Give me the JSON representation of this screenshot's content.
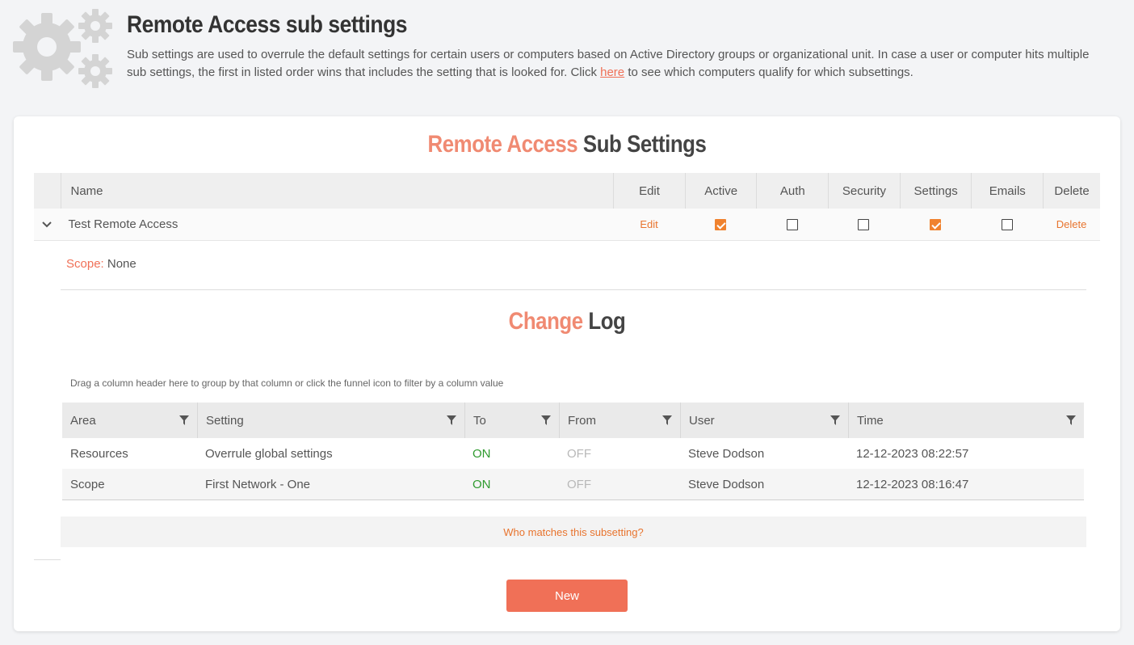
{
  "header": {
    "title": "Remote Access sub settings",
    "description_before_link": "Sub settings are used to overrule the default settings for certain users or computers based on Active Directory groups or organizational unit. In case a user or computer hits multiple sub settings, the first in listed order wins that includes the setting that is looked for. Click ",
    "link_text": "here",
    "description_after_link": " to see which computers qualify for which subsettings.",
    "icon": "gears-icon"
  },
  "card": {
    "title_accent": "Remote Access",
    "title_rest": " Sub Settings"
  },
  "main_grid": {
    "columns": [
      "Name",
      "Edit",
      "Active",
      "Auth",
      "Security",
      "Settings",
      "Emails",
      "Delete"
    ],
    "rows": [
      {
        "name": "Test Remote Access",
        "edit_label": "Edit",
        "active": true,
        "auth": false,
        "security": false,
        "settings": true,
        "emails": false,
        "delete_label": "Delete"
      }
    ]
  },
  "detail": {
    "scope_label": "Scope:",
    "scope_value": " None",
    "changelog_title_accent": "Change",
    "changelog_title_rest": " Log",
    "drag_hint": "Drag a column header here to group by that column or click the funnel icon to filter by a column value",
    "log_columns": [
      "Area",
      "Setting",
      "To",
      "From",
      "User",
      "Time"
    ],
    "log_rows": [
      {
        "area": "Resources",
        "setting": "Overrule global settings",
        "to": "ON",
        "from": "OFF",
        "user": "Steve Dodson",
        "time": "12-12-2023 08:22:57"
      },
      {
        "area": "Scope",
        "setting": "First Network - One",
        "to": "ON",
        "from": "OFF",
        "user": "Steve Dodson",
        "time": "12-12-2023 08:16:47"
      }
    ],
    "who_matches": "Who matches this subsetting?"
  },
  "new_button": "New",
  "colors": {
    "accent": "#f07057",
    "link_orange": "#e8742e",
    "checkbox_on": "#f0822e",
    "on_green": "#2e9a2e",
    "off_gray": "#b8b8b8"
  }
}
